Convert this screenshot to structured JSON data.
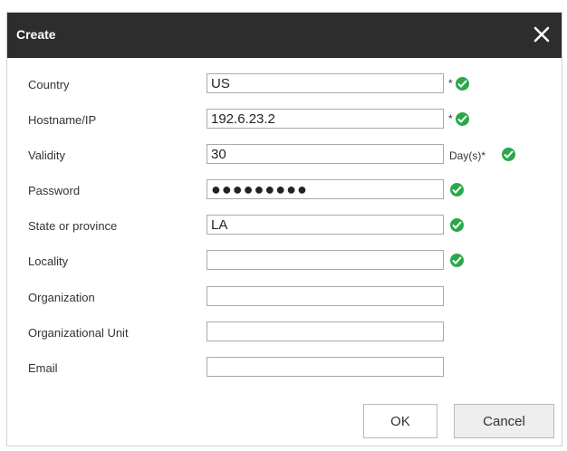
{
  "dialog": {
    "title": "Create",
    "close_icon": "close-icon"
  },
  "form": {
    "country": {
      "label": "Country",
      "value": "US",
      "required": "*"
    },
    "hostname": {
      "label": "Hostname/IP",
      "value": "192.6.23.2",
      "required": "*"
    },
    "validity": {
      "label": "Validity",
      "value": "30",
      "unit": "Day(s)*"
    },
    "password": {
      "label": "Password",
      "value": "●●●●●●●●●"
    },
    "state": {
      "label": "State or province",
      "value": "LA"
    },
    "locality": {
      "label": "Locality",
      "value": ""
    },
    "organization": {
      "label": "Organization",
      "value": ""
    },
    "org_unit": {
      "label": "Organizational Unit",
      "value": ""
    },
    "email": {
      "label": "Email",
      "value": ""
    }
  },
  "buttons": {
    "ok": "OK",
    "cancel": "Cancel"
  },
  "colors": {
    "titlebar": "#2d2d2d",
    "valid_check": "#2aa84a"
  }
}
